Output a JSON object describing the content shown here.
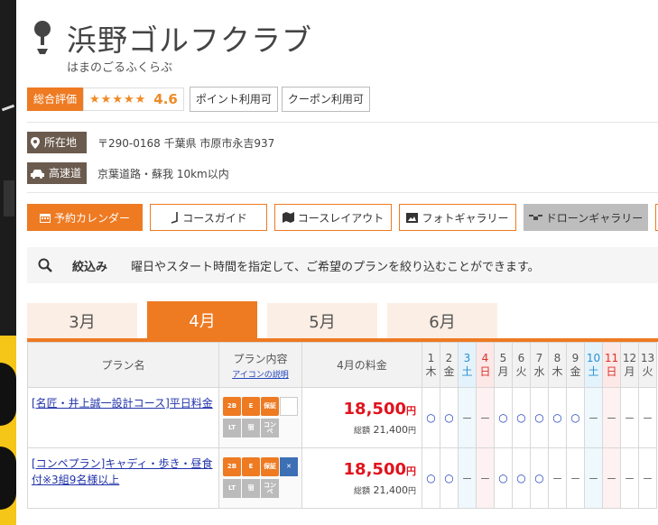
{
  "course": {
    "name": "浜野ゴルフクラブ",
    "kana": "はまのごるふくらぶ"
  },
  "rating": {
    "label": "総合評価",
    "stars": "★★★★★",
    "score": "4.6"
  },
  "tags": [
    "ポイント利用可",
    "クーポン利用可"
  ],
  "info": {
    "address_label": "所在地",
    "address": "〒290-0168 千葉県 市原市永吉937",
    "highway_label": "高速道",
    "highway": "京葉道路・蘇我 10km以内"
  },
  "nav": {
    "calendar": "予約カレンダー",
    "course_guide": "コースガイド",
    "course_layout": "コースレイアウト",
    "photo_gallery": "フォトギャラリー",
    "drone_gallery": "ドローンギャラリー"
  },
  "filter": {
    "title": "絞込み",
    "description": "曜日やスタート時間を指定して、ご希望のプランを絞り込むことができます。"
  },
  "months": [
    "3月",
    "4月",
    "5月",
    "6月"
  ],
  "active_month": "4月",
  "table": {
    "col_plan": "プラン名",
    "col_content": "プラン内容",
    "col_content_link": "アイコンの説明",
    "col_price": "4月の料金",
    "days": [
      {
        "d": "1",
        "w": "木",
        "type": "weekday"
      },
      {
        "d": "2",
        "w": "金",
        "type": "weekday"
      },
      {
        "d": "3",
        "w": "土",
        "type": "sat"
      },
      {
        "d": "4",
        "w": "日",
        "type": "sun"
      },
      {
        "d": "5",
        "w": "月",
        "type": "weekday"
      },
      {
        "d": "6",
        "w": "火",
        "type": "weekday"
      },
      {
        "d": "7",
        "w": "水",
        "type": "weekday"
      },
      {
        "d": "8",
        "w": "木",
        "type": "weekday"
      },
      {
        "d": "9",
        "w": "金",
        "type": "weekday"
      },
      {
        "d": "10",
        "w": "土",
        "type": "sat"
      },
      {
        "d": "11",
        "w": "日",
        "type": "sun"
      },
      {
        "d": "12",
        "w": "月",
        "type": "weekday"
      },
      {
        "d": "13",
        "w": "火",
        "type": "weekday"
      }
    ],
    "rows": [
      {
        "name": "[名匠・井上誠一設計コース]平日料金",
        "price": "18,500",
        "price_unit": "円",
        "total_label": "総額",
        "total": "21,400",
        "total_unit": "円",
        "icons": [
          "2B",
          "E",
          "保証",
          "no-compe",
          "LT",
          "宿",
          "コンペ特典",
          "none"
        ],
        "availability": [
          "○",
          "○",
          "－",
          "－",
          "○",
          "○",
          "○",
          "○",
          "○",
          "－",
          "－",
          "－",
          "－"
        ]
      },
      {
        "name": "[コンペプラン]キャディ・歩き・昼食付※3組9名様以上",
        "price": "18,500",
        "price_unit": "円",
        "total_label": "総額",
        "total": "21,400",
        "total_unit": "円",
        "icons": [
          "2B",
          "E",
          "保証",
          "compe",
          "LT",
          "宿",
          "コンペ特典",
          "none"
        ],
        "availability": [
          "○",
          "○",
          "－",
          "－",
          "○",
          "○",
          "○",
          "－",
          "－",
          "－",
          "－",
          "－",
          "－"
        ]
      }
    ]
  },
  "colors": {
    "accent": "#ee7a22",
    "info_label": "#6b5b4e",
    "price": "#e0131d",
    "link": "#2233aa"
  }
}
